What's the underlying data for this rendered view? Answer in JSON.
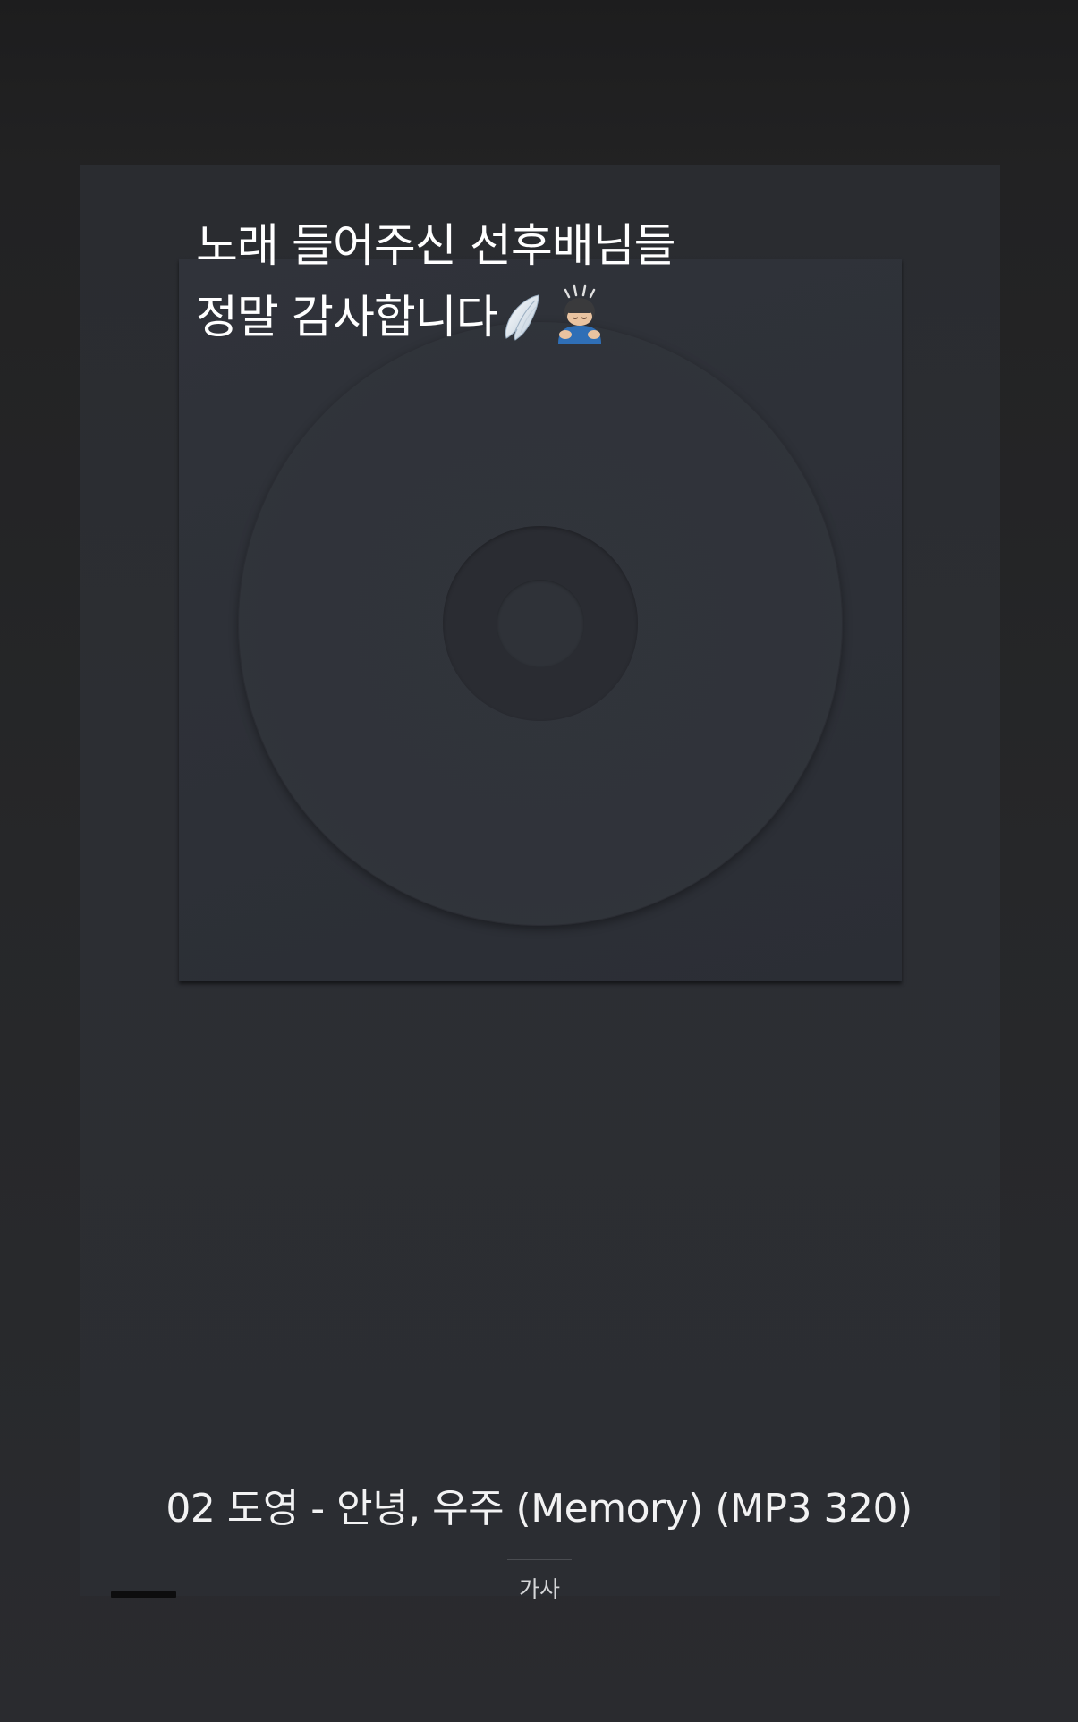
{
  "story": {
    "caption_line_1": "노래 들어주신 선후배님들",
    "caption_line_2": "정말 감사합니다",
    "caption_emojis": [
      "wing-icon",
      "bowing-person-icon"
    ]
  },
  "player": {
    "album_art": "disc-placeholder-icon",
    "track_title": "02 도영 - 안녕, 우주 (Memory) (MP3 320)",
    "lyrics_tab_label": "가사"
  }
}
